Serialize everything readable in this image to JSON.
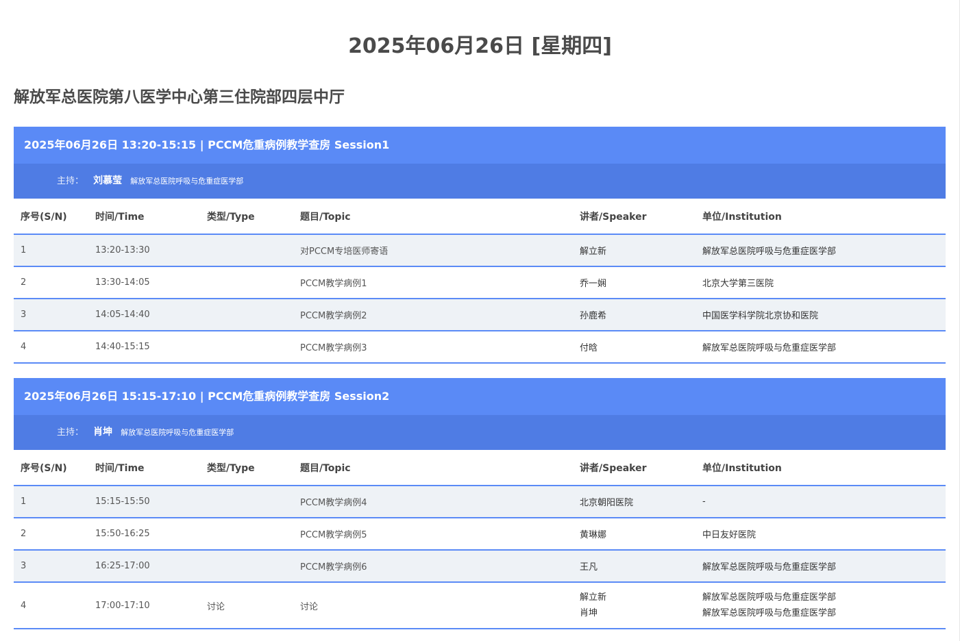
{
  "page": {
    "date_title": "2025年06月26日 [星期四]",
    "venue": "解放军总医院第八医学中心第三住院部四层中厅"
  },
  "columns": {
    "sn": "序号(S/N)",
    "time": "时间/Time",
    "type": "类型/Type",
    "topic": "题目/Topic",
    "speaker": "讲者/Speaker",
    "institution": "单位/Institution"
  },
  "chair_label": "主持：",
  "sessions": [
    {
      "title": "2025年06月26日 13:20-15:15 | PCCM危重病例教学查房 Session1",
      "chair_name": "刘慕莹",
      "chair_institution": "解放军总医院呼吸与危重症医学部",
      "rows": [
        {
          "sn": "1",
          "time": "13:20-13:30",
          "type": "",
          "topic": "对PCCM专培医师寄语",
          "speakers": [
            "解立新"
          ],
          "institutions": [
            "解放军总医院呼吸与危重症医学部"
          ]
        },
        {
          "sn": "2",
          "time": "13:30-14:05",
          "type": "",
          "topic": "PCCM教学病例1",
          "speakers": [
            "乔一娴"
          ],
          "institutions": [
            "北京大学第三医院"
          ]
        },
        {
          "sn": "3",
          "time": "14:05-14:40",
          "type": "",
          "topic": "PCCM教学病例2",
          "speakers": [
            "孙鹿希"
          ],
          "institutions": [
            "中国医学科学院北京协和医院"
          ]
        },
        {
          "sn": "4",
          "time": "14:40-15:15",
          "type": "",
          "topic": "PCCM教学病例3",
          "speakers": [
            "付晗"
          ],
          "institutions": [
            "解放军总医院呼吸与危重症医学部"
          ]
        }
      ]
    },
    {
      "title": "2025年06月26日 15:15-17:10 | PCCM危重病例教学查房 Session2",
      "chair_name": "肖坤",
      "chair_institution": "解放军总医院呼吸与危重症医学部",
      "rows": [
        {
          "sn": "1",
          "time": "15:15-15:50",
          "type": "",
          "topic": "PCCM教学病例4",
          "speakers": [
            "北京朝阳医院"
          ],
          "institutions": [
            "-"
          ]
        },
        {
          "sn": "2",
          "time": "15:50-16:25",
          "type": "",
          "topic": "PCCM教学病例5",
          "speakers": [
            "黄琳娜"
          ],
          "institutions": [
            "中日友好医院"
          ]
        },
        {
          "sn": "3",
          "time": "16:25-17:00",
          "type": "",
          "topic": "PCCM教学病例6",
          "speakers": [
            "王凡"
          ],
          "institutions": [
            "解放军总医院呼吸与危重症医学部"
          ]
        },
        {
          "sn": "4",
          "time": "17:00-17:10",
          "type": "讨论",
          "topic": "讨论",
          "speakers": [
            "解立新",
            "肖坤"
          ],
          "institutions": [
            "解放军总医院呼吸与危重症医学部",
            "解放军总医院呼吸与危重症医学部"
          ]
        }
      ]
    }
  ]
}
